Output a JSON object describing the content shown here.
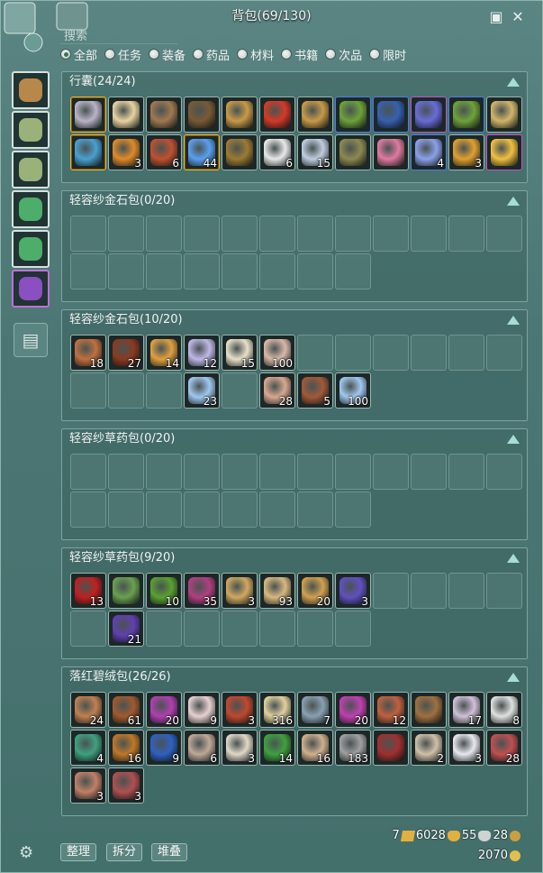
{
  "title": "背包(69/130)",
  "search_placeholder": "搜索",
  "filters": [
    {
      "label": "全部",
      "selected": true
    },
    {
      "label": "任务",
      "selected": false
    },
    {
      "label": "装备",
      "selected": false
    },
    {
      "label": "药品",
      "selected": false
    },
    {
      "label": "材料",
      "selected": false
    },
    {
      "label": "书籍",
      "selected": false
    },
    {
      "label": "次品",
      "selected": false
    },
    {
      "label": "限时",
      "selected": false
    }
  ],
  "bag_tabs": [
    {
      "icon": "cloth-bag-icon",
      "color": "#b8874a"
    },
    {
      "icon": "bamboo-bag-icon",
      "color": "#9ab27a"
    },
    {
      "icon": "bamboo-bag-icon",
      "color": "#9ab27a"
    },
    {
      "icon": "green-bag-icon",
      "color": "#4cae6a"
    },
    {
      "icon": "green-bag-icon",
      "color": "#4cae6a"
    },
    {
      "icon": "purple-bag-icon",
      "color": "#8a4fc0"
    }
  ],
  "panels": [
    {
      "title": "行囊(24/24)",
      "rows": 2,
      "slots": [
        {
          "icon": "potion-jar-icon",
          "color": "#b9b3c8",
          "quality": "gold"
        },
        {
          "icon": "bottle-icon",
          "color": "#e8d3a0",
          "quality": ""
        },
        {
          "icon": "shovel-icon",
          "color": "#a07850",
          "quality": ""
        },
        {
          "icon": "rope-icon",
          "color": "#7a5a34",
          "quality": ""
        },
        {
          "icon": "seal-token-icon",
          "color": "#c89a48",
          "quality": ""
        },
        {
          "icon": "firecracker-icon",
          "color": "#d43a28",
          "quality": ""
        },
        {
          "icon": "seal-token-icon",
          "color": "#c89a48",
          "quality": ""
        },
        {
          "icon": "herb-bundle-icon",
          "color": "#6ea23a",
          "quality": "blue"
        },
        {
          "icon": "vase-icon",
          "color": "#3760b0",
          "quality": "blue"
        },
        {
          "icon": "book-icon",
          "color": "#6a6cd8",
          "quality": "purple"
        },
        {
          "icon": "herb-bundle-icon",
          "color": "#6ea23a",
          "quality": "blue"
        },
        {
          "icon": "pouch-icon",
          "color": "#d2b56a",
          "quality": ""
        },
        {
          "icon": "armor-icon",
          "color": "#4aa0d0",
          "quality": "gold"
        },
        {
          "icon": "chest-icon",
          "color": "#e08a2a",
          "quality": "",
          "count": "3"
        },
        {
          "icon": "food-basket-icon",
          "color": "#c05030",
          "quality": "",
          "count": "6"
        },
        {
          "icon": "crystal-icon",
          "color": "#5aa0f0",
          "quality": "gold",
          "count": "44"
        },
        {
          "icon": "cauldron-icon",
          "color": "#9c7a34",
          "quality": ""
        },
        {
          "icon": "dice-icon",
          "color": "#e8e8e8",
          "quality": "",
          "count": "6"
        },
        {
          "icon": "scroll-icon",
          "color": "#c0cde0",
          "quality": "",
          "count": "15"
        },
        {
          "icon": "cart-icon",
          "color": "#8c8a50",
          "quality": ""
        },
        {
          "icon": "flower-icon",
          "color": "#e07aa0",
          "quality": ""
        },
        {
          "icon": "bowl-icon",
          "color": "#8ca0e8",
          "quality": "blue",
          "count": "4"
        },
        {
          "icon": "gold-ingot-icon",
          "color": "#e0a030",
          "quality": "",
          "count": "3"
        },
        {
          "icon": "gold-ingot-icon",
          "color": "#f0c040",
          "quality": "purple"
        }
      ]
    },
    {
      "title": "轻容纱金石包(0/20)",
      "rows": 2,
      "slots": []
    },
    {
      "title": "轻容纱金石包(10/20)",
      "rows": 2,
      "slots": [
        {
          "icon": "ore-icon",
          "color": "#c07040",
          "count": "18"
        },
        {
          "icon": "ore-icon",
          "color": "#8a3a20",
          "count": "27"
        },
        {
          "icon": "ore-icon",
          "color": "#e0a040",
          "count": "14"
        },
        {
          "icon": "ore-icon",
          "color": "#c0b8e8",
          "count": "12"
        },
        {
          "icon": "ore-icon",
          "color": "#e8e0c8",
          "count": "15"
        },
        {
          "icon": "ore-icon",
          "color": "#d8b8a8",
          "count": "100"
        },
        null,
        null,
        null,
        null,
        null,
        null,
        null,
        null,
        null,
        {
          "icon": "ore-icon",
          "color": "#a0c8f0",
          "count": "23"
        },
        null,
        {
          "icon": "ore-icon",
          "color": "#d8a890",
          "count": "28"
        },
        {
          "icon": "ore-icon",
          "color": "#a05a38",
          "count": "5"
        },
        {
          "icon": "ore-icon",
          "color": "#a0c8f0",
          "count": "100"
        }
      ]
    },
    {
      "title": "轻容纱草药包(0/20)",
      "rows": 2,
      "slots": []
    },
    {
      "title": "轻容纱草药包(9/20)",
      "rows": 2,
      "slots": [
        {
          "icon": "herb-icon",
          "color": "#c02020",
          "count": "13"
        },
        {
          "icon": "herb-icon",
          "color": "#6aa050",
          "count": ""
        },
        {
          "icon": "herb-icon",
          "color": "#5aa030",
          "count": "10"
        },
        {
          "icon": "herb-icon",
          "color": "#b04080",
          "count": "35"
        },
        {
          "icon": "herb-icon",
          "color": "#d0a860",
          "count": "3"
        },
        {
          "icon": "herb-icon",
          "color": "#d8b880",
          "count": "93"
        },
        {
          "icon": "herb-icon",
          "color": "#d0a050",
          "count": "20"
        },
        {
          "icon": "herb-icon",
          "color": "#6050c0",
          "count": "3"
        },
        null,
        null,
        null,
        null,
        null,
        {
          "icon": "herb-icon",
          "color": "#6040b0",
          "count": "21"
        }
      ]
    },
    {
      "title": "落红碧绒包(26/26)",
      "rows": 3,
      "slots": [
        {
          "icon": "material-icon",
          "color": "#c08050",
          "count": "24"
        },
        {
          "icon": "material-icon",
          "color": "#a05a30",
          "count": "61"
        },
        {
          "icon": "material-icon",
          "color": "#b040b0",
          "count": "20"
        },
        {
          "icon": "material-icon",
          "color": "#e8d0d0",
          "count": "9"
        },
        {
          "icon": "material-icon",
          "color": "#c04830",
          "count": "3"
        },
        {
          "icon": "material-icon",
          "color": "#e0d0a0",
          "count": "316"
        },
        {
          "icon": "material-icon",
          "color": "#8aa0b0",
          "count": "7"
        },
        {
          "icon": "material-icon",
          "color": "#c040b0",
          "count": "20"
        },
        {
          "icon": "material-icon",
          "color": "#c06040",
          "count": "12"
        },
        {
          "icon": "material-icon",
          "color": "#a07040",
          "count": ""
        },
        {
          "icon": "material-icon",
          "color": "#d0c0d8",
          "count": "17"
        },
        {
          "icon": "material-icon",
          "color": "#e0e0e0",
          "count": "8"
        },
        {
          "icon": "material-icon",
          "color": "#40a080",
          "count": "4"
        },
        {
          "icon": "material-icon",
          "color": "#c07828",
          "count": "16"
        },
        {
          "icon": "material-icon",
          "color": "#3060c0",
          "count": "9"
        },
        {
          "icon": "material-icon",
          "color": "#c0a898",
          "count": "6"
        },
        {
          "icon": "material-icon",
          "color": "#e0d8c8",
          "count": "3"
        },
        {
          "icon": "material-icon",
          "color": "#40a040",
          "count": "14"
        },
        {
          "icon": "material-icon",
          "color": "#d0b090",
          "count": "16"
        },
        {
          "icon": "material-icon",
          "color": "#a0a0a0",
          "count": "183"
        },
        {
          "icon": "material-icon",
          "color": "#a03030",
          "count": ""
        },
        {
          "icon": "material-icon",
          "color": "#d0c0a8",
          "count": "2"
        },
        {
          "icon": "material-icon",
          "color": "#e8e8f0",
          "count": "3"
        },
        {
          "icon": "material-icon",
          "color": "#c05050",
          "count": "28"
        },
        {
          "icon": "material-icon",
          "color": "#c08068",
          "count": "3"
        },
        {
          "icon": "material-icon",
          "color": "#b05050",
          "count": "3"
        }
      ]
    }
  ],
  "buttons": {
    "sort": "整理",
    "split": "拆分",
    "stack": "堆叠"
  },
  "money": {
    "gold_ingot": "7",
    "gold": "6028",
    "silver": "55",
    "copper": "28",
    "coupon": "2070"
  }
}
